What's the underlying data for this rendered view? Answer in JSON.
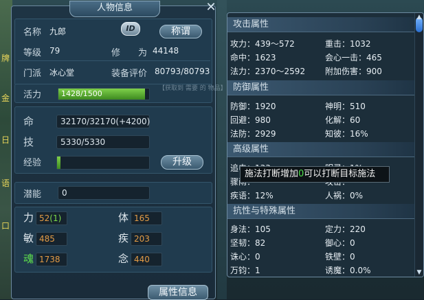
{
  "window": {
    "title": "人物信息",
    "close_icon": "close-icon"
  },
  "left_strip_chars": [
    "牌",
    "金",
    "日",
    "语",
    "口"
  ],
  "profile": {
    "name_label": "名称",
    "name_value": "九郎",
    "id_badge": "ID",
    "title_button": "称谓",
    "level_label": "等级",
    "level_value": "79",
    "cultivation_label": "修　　为",
    "cultivation_value": "44148",
    "sect_label": "门派",
    "sect_value": "冰心堂",
    "equip_label": "装备评价",
    "equip_value": "80793/80793"
  },
  "vitals": {
    "vigor_label": "活力",
    "vigor_value": "1428/1500",
    "vigor_fraction": 0.952,
    "hp_label": "命",
    "hp_value": "32170/32170(+4200)",
    "skill_label": "技",
    "skill_value": "5330/5330",
    "exp_label": "经验",
    "exp_fraction": 0.04,
    "upgrade_button": "升级",
    "potential_label": "潜能",
    "potential_value": "0"
  },
  "attributes": [
    {
      "label": "力",
      "value": "52",
      "bonus": "(1)"
    },
    {
      "label": "体",
      "value": "165",
      "bonus": ""
    },
    {
      "label": "敏",
      "value": "485",
      "bonus": ""
    },
    {
      "label": "疾",
      "value": "203",
      "bonus": ""
    },
    {
      "label": "魂",
      "value": "1738",
      "bonus": ""
    },
    {
      "label": "念",
      "value": "440",
      "bonus": ""
    }
  ],
  "attr_info_button": "属性信息",
  "attack": {
    "header": "攻击属性",
    "rows": [
      [
        "攻力：439～572",
        "重击：1032"
      ],
      [
        "命中：1623",
        "会心一击：465"
      ],
      [
        "法力：2370～2592",
        "附加伤害：900"
      ]
    ]
  },
  "defense": {
    "header": "防御属性",
    "rows": [
      [
        "防御：1920",
        "神明：510"
      ],
      [
        "回避：980",
        "化解：60"
      ],
      [
        "法防：2929",
        "知彼：16%"
      ]
    ]
  },
  "advanced": {
    "header": "高级属性",
    "rows": [
      [
        "追电：133",
        "明灵：1%"
      ],
      [
        "骤雨：",
        "攻击："
      ],
      [
        "疾语：12%",
        "人祸：0%"
      ]
    ]
  },
  "special": {
    "header": "抗性与特殊属性",
    "rows": [
      [
        "身法：105",
        "定力：220"
      ],
      [
        "坚韧：82",
        "御心：0"
      ],
      [
        "诛心：0",
        "铁壁：0"
      ],
      [
        "万钧：1",
        "诱魔：0.0%"
      ]
    ]
  },
  "tooltip": {
    "prefix": "施法打断增加",
    "value": "0",
    "suffix": "可以打断目标施法"
  },
  "mid_bg_text": "【获取到 需要 的 物品】",
  "colors": {
    "accent_green": "#4fe04a",
    "stat_orange": "#e39b45",
    "bar_green": "#6cc23a"
  }
}
